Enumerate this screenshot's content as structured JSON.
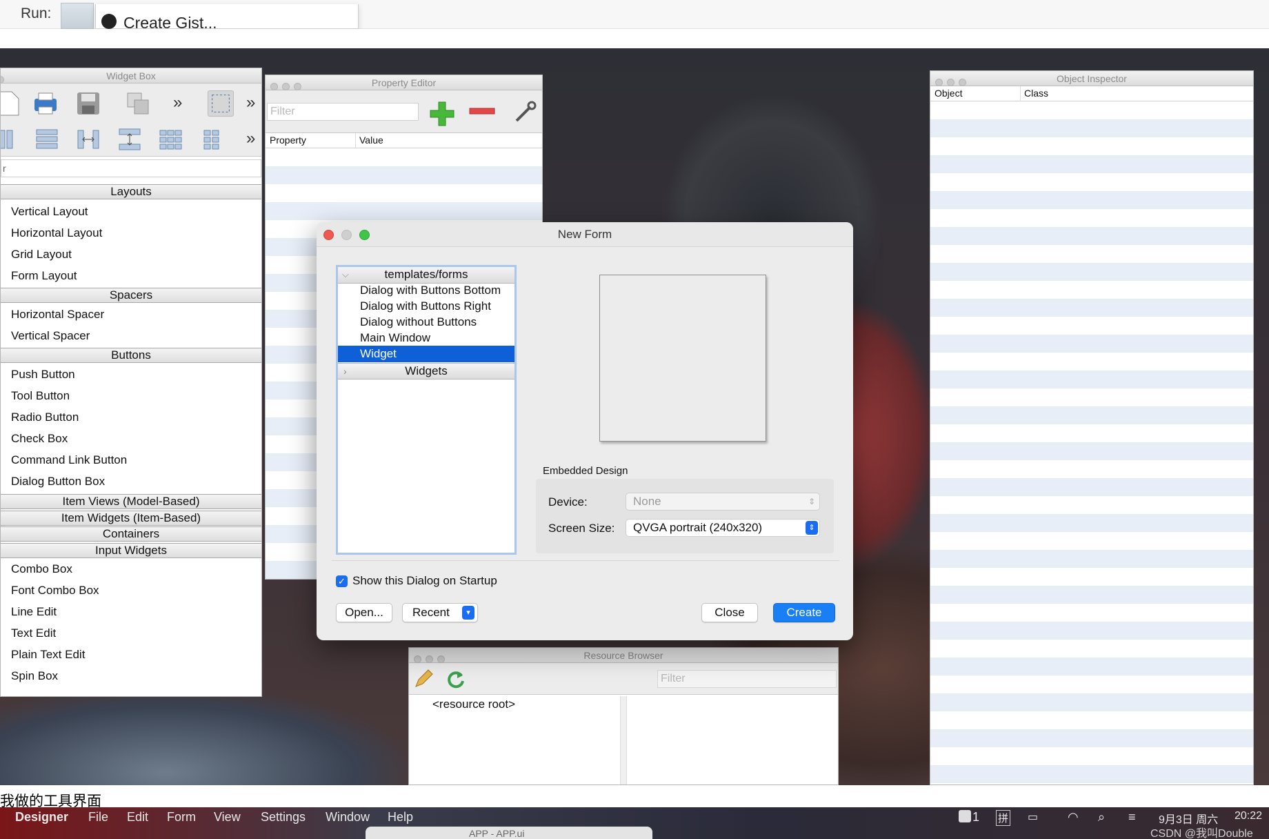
{
  "top": {
    "run_label": "Run:",
    "gist_label": "Create Gist..."
  },
  "widget_box": {
    "title": "Widget Box",
    "filter": "r",
    "categories": [
      {
        "label": "Layouts",
        "items": [
          "Vertical Layout",
          "Horizontal Layout",
          "Grid Layout",
          "Form Layout"
        ]
      },
      {
        "label": "Spacers",
        "items": [
          "Horizontal Spacer",
          "Vertical Spacer"
        ]
      },
      {
        "label": "Buttons",
        "items": [
          "Push Button",
          "Tool Button",
          "Radio Button",
          "Check Box",
          "Command Link Button",
          "Dialog Button Box"
        ]
      },
      {
        "label": "Item Views (Model-Based)",
        "items": []
      },
      {
        "label": "Item Widgets (Item-Based)",
        "items": []
      },
      {
        "label": "Containers",
        "items": []
      },
      {
        "label": "Input Widgets",
        "items": [
          "Combo Box",
          "Font Combo Box",
          "Line Edit",
          "Text Edit",
          "Plain Text Edit",
          "Spin Box"
        ]
      }
    ]
  },
  "property_editor": {
    "title": "Property Editor",
    "filter_placeholder": "Filter",
    "col_property": "Property",
    "col_value": "Value"
  },
  "object_inspector": {
    "title": "Object Inspector",
    "col_object": "Object",
    "col_class": "Class"
  },
  "new_form": {
    "title": "New Form",
    "tree_root": "templates/forms",
    "templates": [
      "Dialog with Buttons Bottom",
      "Dialog with Buttons Right",
      "Dialog without Buttons",
      "Main Window",
      "Widget"
    ],
    "selected": "Widget",
    "widgets_group": "Widgets",
    "embedded_design": "Embedded Design",
    "device_label": "Device:",
    "device_value": "None",
    "screen_label": "Screen Size:",
    "screen_value": "QVGA portrait (240x320)",
    "show_startup": "Show this Dialog on Startup",
    "open": "Open...",
    "recent": "Recent",
    "close": "Close",
    "create": "Create"
  },
  "resource_browser": {
    "title": "Resource Browser",
    "filter_placeholder": "Filter",
    "root": "<resource root>"
  },
  "caption": "我做的工具界面",
  "menubar": {
    "items": [
      "Designer",
      "File",
      "Edit",
      "Form",
      "View",
      "Settings",
      "Window",
      "Help"
    ],
    "date": "9月3日 周六",
    "time": "20:22",
    "ime": "拼",
    "badge": "1",
    "watermark": "CSDN @我叫Double",
    "app_title": "APP - APP.ui"
  },
  "colors": {
    "accent": "#1a6cf0",
    "selection": "#0f5fd8",
    "stripe": "#e8eef8"
  }
}
